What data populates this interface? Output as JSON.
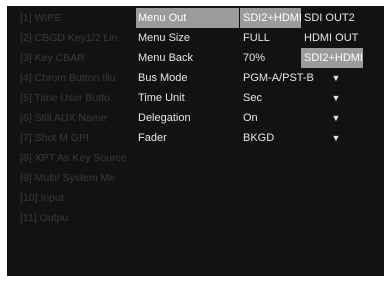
{
  "main_menu": [
    {
      "num": "[1]",
      "label": "WIPE"
    },
    {
      "num": "[2]",
      "label": "CBGD   Key1/2 Lin"
    },
    {
      "num": "[3]",
      "label": "Key     CBAR"
    },
    {
      "num": "[4]",
      "label": "Chrom  Button Illu"
    },
    {
      "num": "[5]",
      "label": "Time    User Butto"
    },
    {
      "num": "[6]",
      "label": "Still     AUX Name"
    },
    {
      "num": "[7]",
      "label": "Shot M GPI"
    },
    {
      "num": "[8]",
      "label": "XPT As Key Source"
    },
    {
      "num": "[9]",
      "label": "Multi/ System Me"
    },
    {
      "num": "[10]",
      "label": "Input"
    },
    {
      "num": "[11]",
      "label": "Outpu"
    }
  ],
  "settings": [
    {
      "label": "Menu Out",
      "value": "SDI2+HDMI",
      "arrow": ""
    },
    {
      "label": "Menu Size",
      "value": "FULL",
      "arrow": ""
    },
    {
      "label": "Menu Back",
      "value": "70%",
      "arrow": ""
    },
    {
      "label": "Bus Mode",
      "value": "PGM-A/PST-B",
      "arrow": "▼"
    },
    {
      "label": "Time Unit",
      "value": "Sec",
      "arrow": "▼"
    },
    {
      "label": "Delegation",
      "value": "On",
      "arrow": "▼"
    },
    {
      "label": "Fader",
      "value": "BKGD",
      "arrow": "▼"
    }
  ],
  "dropdown_options": [
    "SDI OUT2",
    "HDMI OUT",
    "SDI2+HDMI"
  ],
  "colors": {
    "background": "#121212",
    "highlight": "#9b9b9b",
    "text": "#e6e6e6",
    "dimmed_text": "#3a3a3a"
  }
}
